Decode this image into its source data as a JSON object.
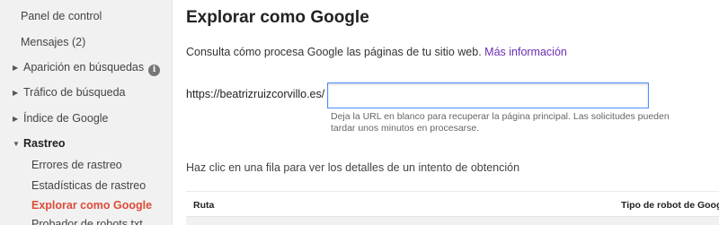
{
  "sidebar": {
    "items": [
      {
        "label": "Panel de control"
      },
      {
        "label": "Mensajes (2)"
      },
      {
        "label": "Aparición en búsquedas"
      },
      {
        "label": "Tráfico de búsqueda"
      },
      {
        "label": "Índice de Google"
      },
      {
        "label": "Rastreo"
      },
      {
        "label": "Errores de rastreo"
      },
      {
        "label": "Estadísticas de rastreo"
      },
      {
        "label": "Explorar como Google"
      },
      {
        "label": "Probador de robots.txt"
      }
    ],
    "info_icon_glyph": "i"
  },
  "main": {
    "title": "Explorar como Google",
    "description": "Consulta cómo procesa Google las páginas de tu sitio web.",
    "more_info_link": "Más información",
    "url_prefix": "https://beatrizruizcorvillo.es/",
    "url_input_value": "",
    "hint": "Deja la URL en blanco para recuperar la página principal. Las solicitudes pueden tardar unos minutos en procesarse.",
    "table_caption": "Haz clic en una fila para ver los detalles de un intento de obtención",
    "table": {
      "columns": [
        "Ruta",
        "Tipo de robot de Goog"
      ]
    }
  },
  "colors": {
    "active_nav": "#dd4b39",
    "link": "#6b2fb3",
    "input_focus_border": "#4d90fe",
    "sidebar_bg": "#f1f1f1"
  }
}
